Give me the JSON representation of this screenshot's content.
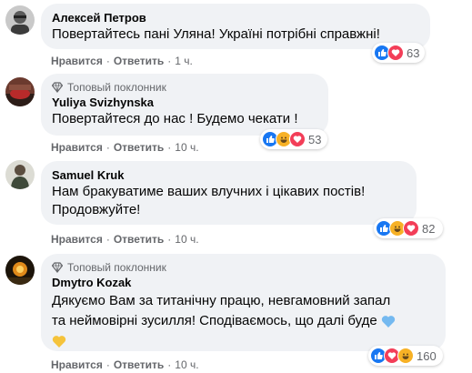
{
  "labels": {
    "like": "Нравится",
    "reply": "Ответить",
    "sep": "·"
  },
  "comments": [
    {
      "author": "Алексей Петров",
      "badge": "",
      "text": "Повертайтесь пані Уляна! Україні потрібні справжні!",
      "time": "1 ч.",
      "reactions": [
        "like",
        "love"
      ],
      "count": "63"
    },
    {
      "author": "Yuliya Svizhynska",
      "badge": "Топовый поклонник",
      "text": "Повертайтеся до нас ! Будемо чекати !",
      "time": "10 ч.",
      "reactions": [
        "like",
        "haha",
        "love"
      ],
      "count": "53"
    },
    {
      "author": "Samuel Kruk",
      "badge": "",
      "text_lines": [
        "Нам бракуватиме ваших влучних і цікавих постів!",
        "Продовжуйте!"
      ],
      "time": "10 ч.",
      "reactions": [
        "like",
        "haha",
        "love"
      ],
      "count": "82"
    },
    {
      "author": "Dmytro Kozak",
      "badge": "Топовый поклонник",
      "text_lines": [
        "Дякуємо Вам за титанічну працю, невгамовний запал",
        "та неймовірні зусилля! Сподіваємось, що далі буде"
      ],
      "emoji": [
        "blue-heart",
        "yellow-heart"
      ],
      "time": "10 ч.",
      "reactions": [
        "like",
        "love",
        "haha"
      ],
      "count": "160"
    }
  ],
  "colors": {
    "bubble": "#f0f2f5",
    "meta": "#65676b",
    "like": "#1877f2",
    "love": "#f33e58",
    "haha": "#f7b125"
  }
}
